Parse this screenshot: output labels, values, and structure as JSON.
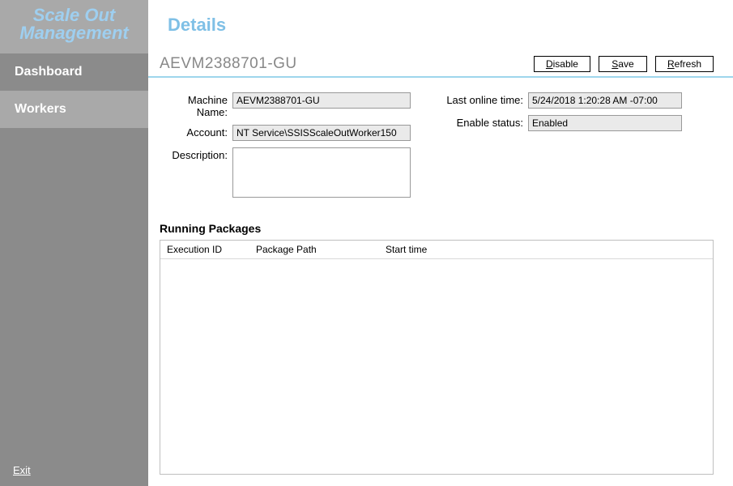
{
  "app": {
    "title_line1": "Scale Out",
    "title_line2": "Management"
  },
  "sidebar": {
    "items": [
      {
        "label": "Dashboard"
      },
      {
        "label": "Workers"
      }
    ],
    "exit": "Exit"
  },
  "main": {
    "header": "Details",
    "worker_id": "AEVM2388701-GU",
    "buttons": {
      "disable_pre": "D",
      "disable_rest": "isable",
      "save_pre": "S",
      "save_rest": "ave",
      "refresh_pre": "R",
      "refresh_rest": "efresh"
    },
    "form": {
      "machine_name_label": "Machine Name:",
      "machine_name": "AEVM2388701-GU",
      "account_label": "Account:",
      "account": "NT Service\\SSISScaleOutWorker150",
      "description_label": "Description:",
      "description": "",
      "last_online_label": "Last online time:",
      "last_online": "5/24/2018 1:20:28 AM -07:00",
      "enable_status_label": "Enable status:",
      "enable_status": "Enabled"
    },
    "running": {
      "title": "Running Packages",
      "columns": {
        "c1": "Execution ID",
        "c2": "Package Path",
        "c3": "Start time"
      }
    }
  }
}
